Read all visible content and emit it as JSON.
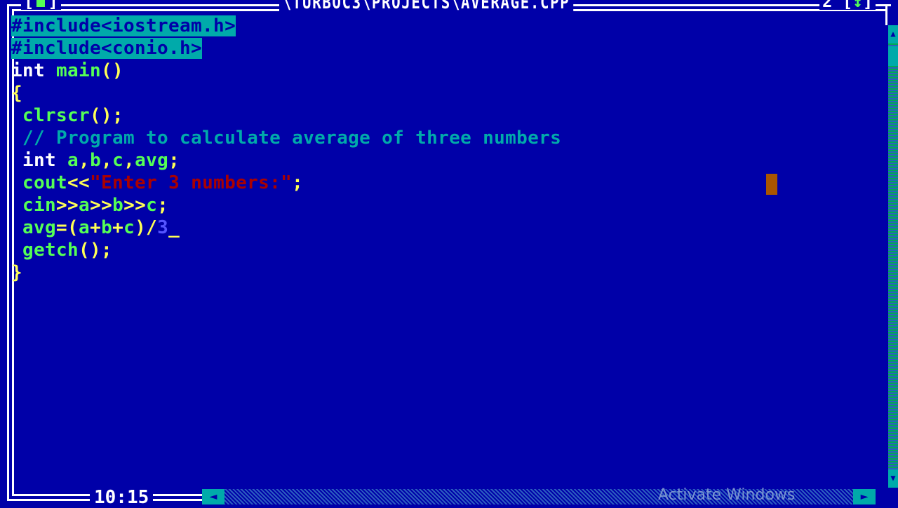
{
  "window": {
    "title": "\\TURBOC3\\PROJECTS\\AVERAGE.CPP",
    "close_box": "[■]",
    "window_number": "2",
    "zoom_box_open": "[",
    "zoom_box_arrow": "↕",
    "zoom_box_close": "]"
  },
  "editor": {
    "lines": [
      [
        {
          "t": "#include<iostream.h>",
          "c": "sel"
        }
      ],
      [
        {
          "t": "#include<conio.h>",
          "c": "sel"
        }
      ],
      [
        {
          "t": "int ",
          "c": "kw"
        },
        {
          "t": "main",
          "c": "id"
        },
        {
          "t": "()",
          "c": "pun"
        }
      ],
      [
        {
          "t": "{",
          "c": "pun"
        }
      ],
      [
        {
          "t": " ",
          "c": "kw"
        },
        {
          "t": "clrscr",
          "c": "id"
        },
        {
          "t": "();",
          "c": "pun"
        }
      ],
      [
        {
          "t": " // Program to calculate average of three numbers",
          "c": "com"
        }
      ],
      [
        {
          "t": " int ",
          "c": "kw"
        },
        {
          "t": "a",
          "c": "id"
        },
        {
          "t": ",",
          "c": "pun"
        },
        {
          "t": "b",
          "c": "id"
        },
        {
          "t": ",",
          "c": "pun"
        },
        {
          "t": "c",
          "c": "id"
        },
        {
          "t": ",",
          "c": "pun"
        },
        {
          "t": "avg",
          "c": "id"
        },
        {
          "t": ";",
          "c": "pun"
        }
      ],
      [
        {
          "t": " ",
          "c": "kw"
        },
        {
          "t": "cout",
          "c": "id"
        },
        {
          "t": "<<",
          "c": "pun"
        },
        {
          "t": "\"Enter 3 numbers:\"",
          "c": "str"
        },
        {
          "t": ";",
          "c": "pun"
        }
      ],
      [
        {
          "t": " ",
          "c": "kw"
        },
        {
          "t": "cin",
          "c": "id"
        },
        {
          "t": ">>",
          "c": "pun"
        },
        {
          "t": "a",
          "c": "id"
        },
        {
          "t": ">>",
          "c": "pun"
        },
        {
          "t": "b",
          "c": "id"
        },
        {
          "t": ">>",
          "c": "pun"
        },
        {
          "t": "c",
          "c": "id"
        },
        {
          "t": ";",
          "c": "pun"
        }
      ],
      [
        {
          "t": " ",
          "c": "kw"
        },
        {
          "t": "avg",
          "c": "id"
        },
        {
          "t": "=(",
          "c": "pun"
        },
        {
          "t": "a",
          "c": "id"
        },
        {
          "t": "+",
          "c": "pun"
        },
        {
          "t": "b",
          "c": "id"
        },
        {
          "t": "+",
          "c": "pun"
        },
        {
          "t": "c",
          "c": "id"
        },
        {
          "t": ")/",
          "c": "pun"
        },
        {
          "t": "3",
          "c": "num"
        },
        {
          "t": "_",
          "c": "cursor"
        }
      ],
      [
        {
          "t": " ",
          "c": "kw"
        },
        {
          "t": "getch",
          "c": "id"
        },
        {
          "t": "();",
          "c": "pun"
        }
      ],
      [
        {
          "t": "}",
          "c": "pun"
        }
      ]
    ]
  },
  "status": {
    "cursor_position": "10:15",
    "modified_marker": "*"
  },
  "scrollbars": {
    "left_arrow": "◄",
    "right_arrow": "►",
    "up_arrow": "▲",
    "down_arrow": "▼"
  },
  "overlay": {
    "watermark": "Activate Windows"
  },
  "colors": {
    "background": "#0000a8",
    "selection": "#00aaaa",
    "identifier": "#55ff55",
    "punctuation": "#ffff55",
    "comment": "#00aaaa",
    "string": "#aa0000",
    "number": "#5555ff",
    "mouse_cursor": "#aa5500"
  }
}
